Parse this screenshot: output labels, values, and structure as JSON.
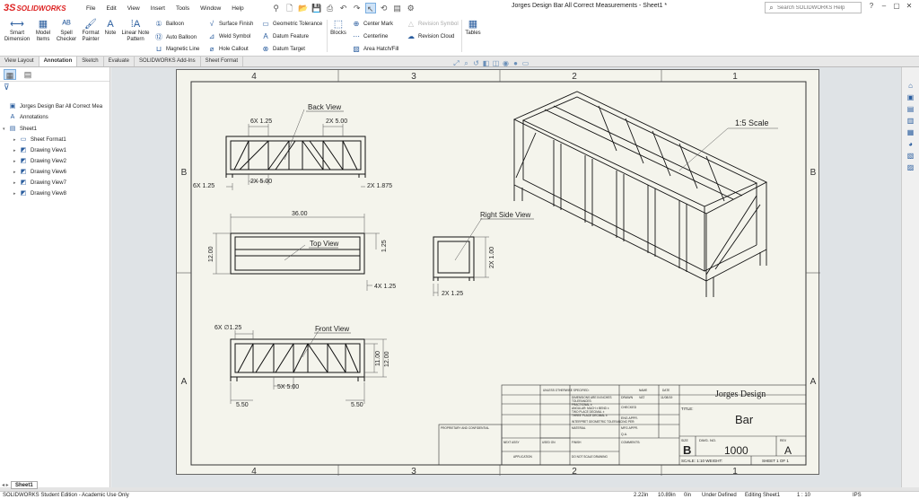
{
  "app": {
    "logo_mark": "3S",
    "logo_word": "SOLIDWORKS",
    "document_title": "Jorges Design Bar All Correct Measurements - Sheet1 *"
  },
  "menu": [
    "File",
    "Edit",
    "View",
    "Insert",
    "Tools",
    "Window",
    "Help"
  ],
  "search": {
    "placeholder": "Search SOLIDWORKS Help"
  },
  "window_buttons": {
    "help": "?",
    "minimize": "–",
    "restore": "▢",
    "close": "✕"
  },
  "ribbon": {
    "smart_dimension": "Smart Dimension",
    "model_items": "Model Items",
    "spell_checker": "Spell Checker",
    "format_painter": "Format Painter",
    "note": "Note",
    "linear_note_pattern": "Linear Note Pattern",
    "balloon": "Balloon",
    "auto_balloon": "Auto Balloon",
    "magnetic_line": "Magnetic Line",
    "surface_finish": "Surface Finish",
    "weld_symbol": "Weld Symbol",
    "hole_callout": "Hole Callout",
    "geometric_tolerance": "Geometric Tolerance",
    "datum_feature": "Datum Feature",
    "datum_target": "Datum Target",
    "blocks": "Blocks",
    "center_mark": "Center Mark",
    "centerline": "Centerline",
    "area_hatch": "Area Hatch/Fill",
    "revision_symbol": "Revision Symbol",
    "revision_cloud": "Revision Cloud",
    "tables": "Tables"
  },
  "tabs": [
    "View Layout",
    "Annotation",
    "Sketch",
    "Evaluate",
    "SOLIDWORKS Add-Ins",
    "Sheet Format"
  ],
  "active_tab": "Annotation",
  "tree": {
    "root": "Jorges Design Bar All Correct Mea",
    "annotations": "Annotations",
    "sheet": "Sheet1",
    "sheet_format": "Sheet Format1",
    "views": [
      "Drawing View1",
      "Drawing View2",
      "Drawing View6",
      "Drawing View7",
      "Drawing View8"
    ]
  },
  "drawing": {
    "zone_columns": [
      "4",
      "3",
      "2",
      "1"
    ],
    "zone_rows": [
      "B",
      "A"
    ],
    "labels": {
      "back_view": "Back View",
      "top_view": "Top View",
      "front_view": "Front View",
      "right_side_view": "Right Side View",
      "scale_note": "1:5 Scale"
    },
    "dims": {
      "back_top_left": "6X 1.25",
      "back_top_right": "2X 5.00",
      "back_left": "6X 1.25",
      "back_bottom": "2X 5.00",
      "back_right": "2X 1.875",
      "top_width": "36.00",
      "top_height": "12.00",
      "top_right": "1.25",
      "top_bottom_right": "4X 1.25",
      "side_height": "2X 1.00",
      "side_bottom": "2X 1.25",
      "front_top": "6X ∅1.25",
      "front_middle": "5X 5.00",
      "front_h1": "11.00",
      "front_h2": "12.00",
      "front_left": "5.50",
      "front_right": "5.50"
    },
    "title_block": {
      "company": "Jorges Design",
      "title_label": "TITLE:",
      "title": "Bar",
      "size_label": "SIZE",
      "size": "B",
      "dwg_no_label": "DWG. NO.",
      "dwg_no": "1000",
      "rev_label": "REV",
      "rev": "A",
      "scale": "SCALE: 1:10  WEIGHT:",
      "sheet": "SHEET 1 OF 1",
      "drawn": "DRAWN",
      "checked": "CHECKED",
      "eng_appr": "ENG APPR.",
      "mfg_appr": "MFG APPR.",
      "qa": "Q.A.",
      "comments": "COMMENTS:",
      "name_label": "NAME",
      "date_label": "DATE",
      "drawn_name": "VAT",
      "drawn_date": "11/08/19",
      "unless": "UNLESS OTHERWISE SPECIFIED:",
      "dims_in": "DIMENSIONS ARE IN INCHES",
      "tolerances": "TOLERANCES:",
      "fractional": "FRACTIONAL ±",
      "angular": "ANGULAR: MACH ±  BEND ±",
      "two_place": "TWO PLACE DECIMAL  ±",
      "three_place": "THREE PLACE DECIMAL  ±",
      "interpret": "INTERPRET GEOMETRIC TOLERANCING PER:",
      "material": "MATERIAL",
      "finish": "FINISH",
      "next_assy": "NEXT ASSY",
      "used_on": "USED ON",
      "application": "APPLICATION",
      "do_not_scale": "DO NOT SCALE DRAWING",
      "proprietary": "PROPRIETARY AND CONFIDENTIAL"
    }
  },
  "sheet_tab": "Sheet1",
  "sheet_tab_arrows": "◂ ▸",
  "status": {
    "edition": "SOLIDWORKS Student Edition - Academic Use Only",
    "x": "2.22in",
    "y": "10.89in",
    "z": "0in",
    "defined": "Under Defined",
    "editing": "Editing Sheet1",
    "scale": "1 : 10",
    "units": "IPS"
  }
}
